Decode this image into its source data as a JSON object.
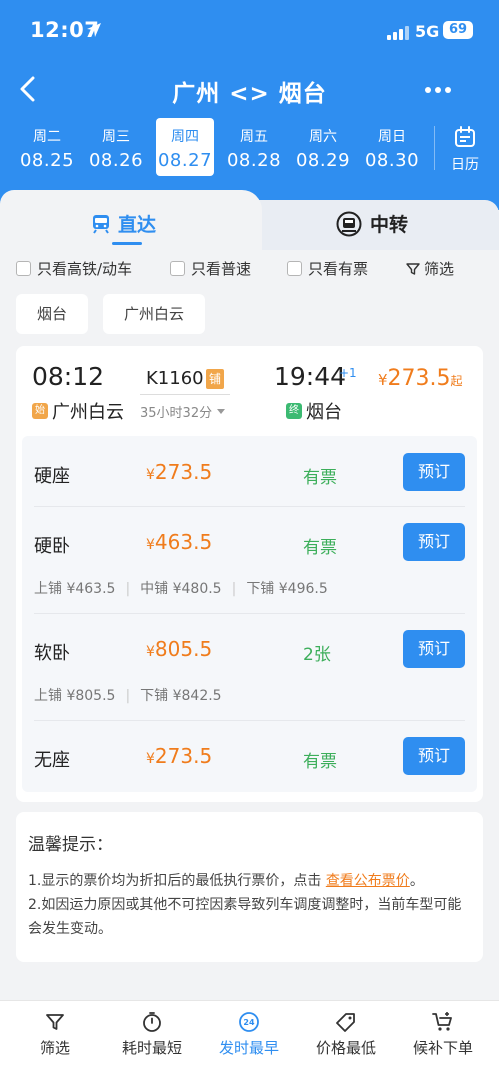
{
  "status": {
    "time": "12:07",
    "network": "5G",
    "battery": "69"
  },
  "nav": {
    "title": "广州 <> 烟台"
  },
  "dates": [
    {
      "weekday": "周二",
      "date": "08.25"
    },
    {
      "weekday": "周三",
      "date": "08.26"
    },
    {
      "weekday": "周四",
      "date": "08.27"
    },
    {
      "weekday": "周五",
      "date": "08.28"
    },
    {
      "weekday": "周六",
      "date": "08.29"
    },
    {
      "weekday": "周日",
      "date": "08.30"
    }
  ],
  "calendar_label": "日历",
  "tabs": {
    "direct": "直达",
    "transfer": "中转"
  },
  "filters": {
    "gaotie": "只看高铁/动车",
    "putong": "只看普速",
    "youpiao": "只看有票",
    "shaixuan": "筛选"
  },
  "stations": [
    "烟台",
    "广州白云"
  ],
  "train": {
    "dep_time": "08:12",
    "arr_time": "19:44",
    "day_plus": "+1",
    "number": "K1160",
    "tag": "铺",
    "duration": "35小时32分",
    "price_cur": "¥",
    "price": "273.5",
    "price_suffix": "起",
    "from_badge": "始",
    "from": "广州白云",
    "to_badge": "终",
    "to": "烟台"
  },
  "seats": [
    {
      "name": "硬座",
      "cur": "¥",
      "price": "273.5",
      "avail": "有票",
      "book": "预订"
    },
    {
      "name": "硬卧",
      "cur": "¥",
      "price": "463.5",
      "avail": "有票",
      "book": "预订",
      "berths": [
        "上铺 ¥463.5",
        "中铺 ¥480.5",
        "下铺 ¥496.5"
      ]
    },
    {
      "name": "软卧",
      "cur": "¥",
      "price": "805.5",
      "avail": "2张",
      "book": "预订",
      "berths": [
        "上铺 ¥805.5",
        "下铺 ¥842.5"
      ]
    },
    {
      "name": "无座",
      "cur": "¥",
      "price": "273.5",
      "avail": "有票",
      "book": "预订"
    }
  ],
  "tips": {
    "title": "温馨提示：",
    "line1_pre": "1.显示的票价均为折扣后的最低执行票价，点击 ",
    "line1_link": "查看公布票价",
    "line1_post": "。",
    "line2": "2.如因运力原因或其他不可控因素导致列车调度调整时，当前车型可能会发生变动。"
  },
  "bottom": {
    "filter": "筛选",
    "shortest": "耗时最短",
    "earliest": "发时最早",
    "earliest_icon_text": "24",
    "cheapest": "价格最低",
    "waitlist": "候补下单"
  },
  "colors": {
    "primary": "#2f8ef0",
    "price": "#f07c1c",
    "available": "#3cae5a"
  }
}
